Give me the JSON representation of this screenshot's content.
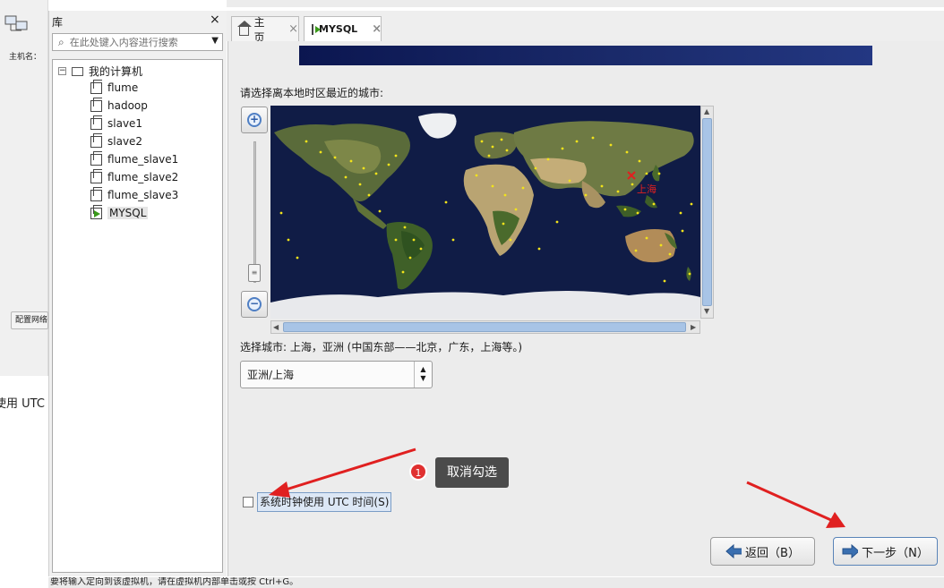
{
  "left_strip": {
    "host_label": "主机名：",
    "net_button": "配置网络",
    "utc_truncated": "使用 UTC"
  },
  "library": {
    "title": "库",
    "close": "×",
    "search_placeholder": "在此处键入内容进行搜索",
    "root": "我的计算机",
    "items": [
      "flume",
      "hadoop",
      "slave1",
      "slave2",
      "flume_slave1",
      "flume_slave2",
      "flume_slave3",
      "MYSQL"
    ]
  },
  "tabs": [
    {
      "label": "主页",
      "close": "×"
    },
    {
      "label": "MYSQL",
      "close": "×"
    }
  ],
  "installer": {
    "prompt": "请选择离本地时区最近的城市:",
    "map_city": "上海",
    "selected_city_text": "选择城市: 上海，亚洲 (中国东部——北京，广东，上海等。)",
    "timezone_value": "亚洲/上海",
    "utc_label": "系统时钟使用 UTC 时间(S)",
    "back_button": "返回（B）",
    "next_button": "下一步（N）"
  },
  "annotation": {
    "number": "1",
    "text": "取消勾选"
  },
  "status_bar": "要将输入定向到该虚拟机，请在虚拟机内部单击或按 Ctrl+G。",
  "colors": {
    "banner": "#1a2a6a",
    "map_ocean": "#0f1a44",
    "arrow_red": "#e02020",
    "city_dot": "#f2e31b"
  }
}
